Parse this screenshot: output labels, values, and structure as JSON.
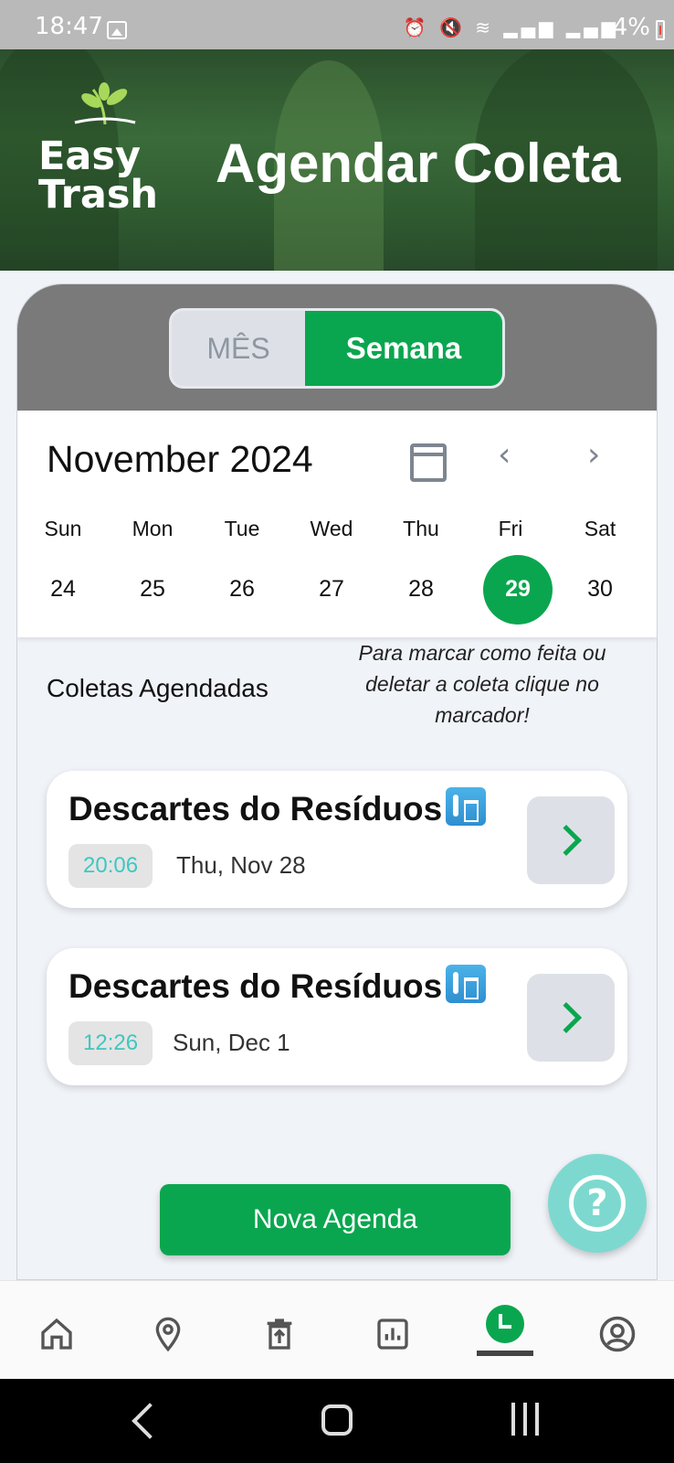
{
  "status_bar": {
    "time": "18:47",
    "battery": "4%"
  },
  "header": {
    "logo_line1": "Easy",
    "logo_line2": "Trash",
    "title": "Agendar Coleta"
  },
  "toggle": {
    "month_label": "MÊS",
    "week_label": "Semana",
    "active": "Semana"
  },
  "calendar": {
    "month_title": "November 2024",
    "days": [
      "Sun",
      "Mon",
      "Tue",
      "Wed",
      "Thu",
      "Fri",
      "Sat"
    ],
    "dates": [
      "24",
      "25",
      "26",
      "27",
      "28",
      "29",
      "30"
    ],
    "selected_date": "29"
  },
  "scheduled": {
    "title": "Coletas Agendadas",
    "hint": "Para marcar como feita ou deletar a coleta clique no marcador!",
    "items": [
      {
        "title": "Descartes do Resíduos",
        "time": "20:06",
        "date": "Thu, Nov 28"
      },
      {
        "title": "Descartes do Resíduos",
        "time": "12:26",
        "date": "Sun, Dec 1"
      }
    ]
  },
  "actions": {
    "new_label": "Nova Agenda"
  },
  "bottom_nav": {
    "items": [
      "home-icon",
      "location-pin-icon",
      "delete-bin-icon",
      "chart-icon",
      "schedule-clock-icon",
      "profile-icon"
    ],
    "active": "schedule-clock-icon"
  },
  "colors": {
    "primary_green": "#0aa64f",
    "accent_teal": "#3ec7c0",
    "fab_teal": "#7dd9cf"
  }
}
